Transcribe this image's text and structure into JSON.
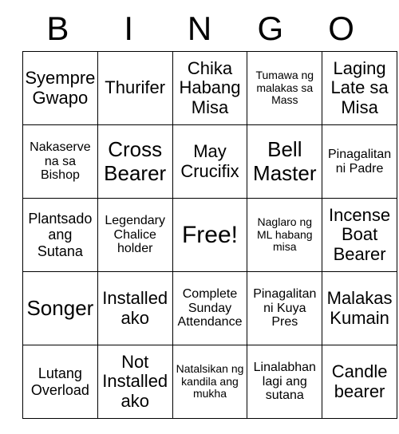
{
  "card": {
    "header": {
      "letters": [
        "B",
        "I",
        "N",
        "G",
        "O"
      ]
    },
    "rows": [
      [
        {
          "text": "Syempre Gwapo",
          "size": "s-md"
        },
        {
          "text": "Thurifer",
          "size": "s-md"
        },
        {
          "text": "Chika Habang Misa",
          "size": "s-md"
        },
        {
          "text": "Tumawa ng malakas sa Mass",
          "size": "s-xxs"
        },
        {
          "text": "Laging Late sa Misa",
          "size": "s-md"
        }
      ],
      [
        {
          "text": "Nakaserve na sa Bishop",
          "size": "s-xs"
        },
        {
          "text": "Cross Bearer",
          "size": "s-lg"
        },
        {
          "text": "May Crucifix",
          "size": "s-md"
        },
        {
          "text": "Bell Master",
          "size": "s-lg"
        },
        {
          "text": "Pinagalitan ni Padre",
          "size": "s-xs"
        }
      ],
      [
        {
          "text": "Plantsado ang Sutana",
          "size": "s-sm"
        },
        {
          "text": "Legendary Chalice holder",
          "size": "s-xs"
        },
        {
          "text": "Free!",
          "size": "s-xl"
        },
        {
          "text": "Naglaro ng ML habang misa",
          "size": "s-xxs"
        },
        {
          "text": "Incense Boat Bearer",
          "size": "s-md"
        }
      ],
      [
        {
          "text": "Songer",
          "size": "s-lg"
        },
        {
          "text": "Installed ako",
          "size": "s-md"
        },
        {
          "text": "Complete Sunday Attendance",
          "size": "s-xs"
        },
        {
          "text": "Pinagalitan ni Kuya Pres",
          "size": "s-xs"
        },
        {
          "text": "Malakas Kumain",
          "size": "s-md"
        }
      ],
      [
        {
          "text": "Lutang Overload",
          "size": "s-sm"
        },
        {
          "text": "Not Installed ako",
          "size": "s-md"
        },
        {
          "text": "Natalsikan ng kandila ang mukha",
          "size": "s-xxs"
        },
        {
          "text": "Linalabhan lagi ang sutana",
          "size": "s-xs"
        },
        {
          "text": "Candle bearer",
          "size": "s-md"
        }
      ]
    ]
  }
}
